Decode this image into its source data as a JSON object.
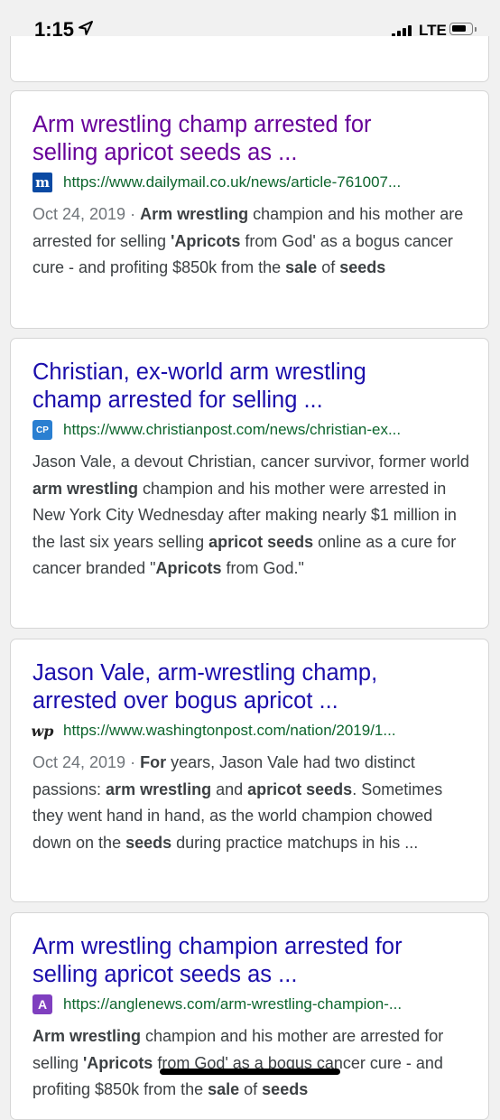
{
  "status_bar": {
    "time": "1:15",
    "network": "LTE",
    "battery_level": 0.75
  },
  "results": [
    {
      "title": "Arm wrestling champ arrested for selling apricot seeds as ...",
      "title_lines": [
        "Arm wrestling champ arrested for",
        "selling apricot seeds as ..."
      ],
      "visited": true,
      "favicon": "dailymail-favicon",
      "favicon_text": "m",
      "url": "https://www.dailymail.co.uk/news/article-761007...",
      "snippet": [
        {
          "t": "Oct 24, 2019 · ",
          "s": "date"
        },
        {
          "t": "Arm wrestling",
          "s": "b"
        },
        {
          "t": " champion and his mother are arrested for selling ",
          "s": ""
        },
        {
          "t": "'Apricots",
          "s": "b"
        },
        {
          "t": " from God' as a bogus cancer cure - and profiting $850k from the ",
          "s": ""
        },
        {
          "t": "sale",
          "s": "b"
        },
        {
          "t": " of ",
          "s": ""
        },
        {
          "t": "seeds",
          "s": "b"
        }
      ]
    },
    {
      "title": "Christian, ex-world arm wrestling champ arrested for selling ...",
      "title_lines": [
        "Christian, ex-world arm wrestling",
        "champ arrested for selling ..."
      ],
      "visited": false,
      "favicon": "christianpost-favicon",
      "favicon_text": "CP",
      "url": "https://www.christianpost.com/news/christian-ex...",
      "snippet": [
        {
          "t": "Jason Vale, a devout Christian, cancer survivor, former world ",
          "s": ""
        },
        {
          "t": "arm wrestling",
          "s": "b"
        },
        {
          "t": " champion and his mother were arrested in New York City Wednesday after making nearly $1 million in the last six years selling ",
          "s": ""
        },
        {
          "t": "apricot seeds",
          "s": "b"
        },
        {
          "t": " online as a cure for cancer branded \"",
          "s": ""
        },
        {
          "t": "Apricots",
          "s": "b"
        },
        {
          "t": " from God.\"",
          "s": ""
        }
      ]
    },
    {
      "title": "Jason Vale, arm-wrestling champ, arrested over bogus apricot ...",
      "title_lines": [
        "Jason Vale, arm-wrestling champ,",
        "arrested over bogus apricot ..."
      ],
      "visited": false,
      "favicon": "washingtonpost-favicon",
      "favicon_text": "wp",
      "url": "https://www.washingtonpost.com/nation/2019/1...",
      "snippet": [
        {
          "t": "Oct 24, 2019 · ",
          "s": "date"
        },
        {
          "t": "For",
          "s": "b"
        },
        {
          "t": " years, Jason Vale had two distinct passions: ",
          "s": ""
        },
        {
          "t": "arm wrestling",
          "s": "b"
        },
        {
          "t": " and ",
          "s": ""
        },
        {
          "t": "apricot seeds",
          "s": "b"
        },
        {
          "t": ". Sometimes they went hand in hand, as the world champion chowed down on the ",
          "s": ""
        },
        {
          "t": "seeds",
          "s": "b"
        },
        {
          "t": " during practice matchups in his ...",
          "s": ""
        }
      ]
    },
    {
      "title": "Arm wrestling champion arrested for selling apricot seeds as ...",
      "title_lines": [
        "Arm wrestling champion arrested for",
        "selling apricot seeds as ..."
      ],
      "visited": false,
      "favicon": "anglenews-favicon",
      "favicon_text": "A",
      "url": "https://anglenews.com/arm-wrestling-champion-...",
      "snippet": [
        {
          "t": "Arm wrestling",
          "s": "b"
        },
        {
          "t": " champion and his mother are arrested for selling ",
          "s": ""
        },
        {
          "t": "'Apricots",
          "s": "b"
        },
        {
          "t": " from God' as a bogus cancer cure - and profiting $850k from the ",
          "s": ""
        },
        {
          "t": "sale",
          "s": "b"
        },
        {
          "t": " of ",
          "s": ""
        },
        {
          "t": "seeds",
          "s": "b"
        }
      ]
    }
  ]
}
